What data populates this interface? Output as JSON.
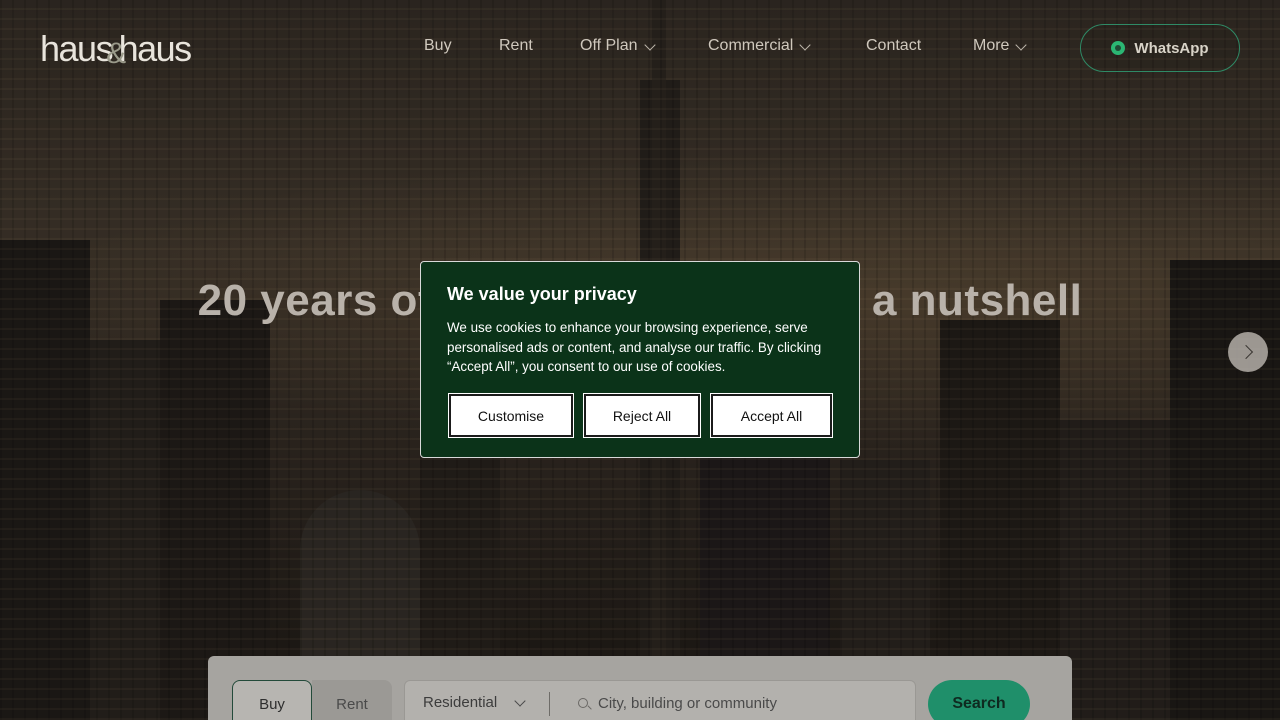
{
  "brand": {
    "logo_left": "haus",
    "logo_amp": "&",
    "logo_right": "haus"
  },
  "nav": {
    "items": [
      {
        "label": "Buy",
        "has_dropdown": false
      },
      {
        "label": "Rent",
        "has_dropdown": false
      },
      {
        "label": "Off Plan",
        "has_dropdown": true
      },
      {
        "label": "Commercial",
        "has_dropdown": true
      },
      {
        "label": "Contact",
        "has_dropdown": false
      },
      {
        "label": "More",
        "has_dropdown": true
      }
    ],
    "whatsapp_label": "WhatsApp"
  },
  "hero": {
    "title": "20 years of Dubai real estate in a nutshell",
    "next_icon": "chevron-right-icon"
  },
  "search": {
    "tabs": [
      "Buy",
      "Rent"
    ],
    "active_tab": "Buy",
    "property_type": "Residential",
    "location_placeholder": "City, building or community",
    "search_label": "Search"
  },
  "cookie_banner": {
    "title": "We value your privacy",
    "text": "We use cookies to enhance your browsing experience, serve personalised ads or content, and analyse our traffic. By clicking “Accept All”, you consent to our use of cookies.",
    "buttons": {
      "customise": "Customise",
      "reject": "Reject All",
      "accept": "Accept All"
    }
  },
  "colors": {
    "accent_green": "#1f8f6a",
    "cookie_bg": "#0b3319",
    "whatsapp_green": "#2bb673"
  }
}
